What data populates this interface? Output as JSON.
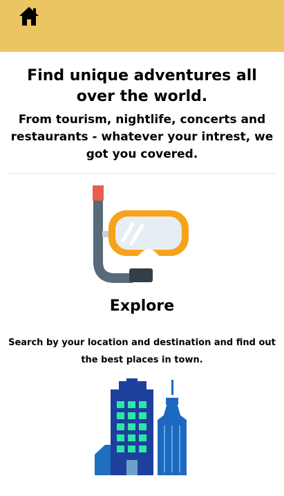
{
  "header": {
    "home_icon": "home-icon",
    "background_color": "#ecc563"
  },
  "hero": {
    "headline": "Find unique adventures all over the world.",
    "subheadline": "From tourism, nightlife, concerts and restaurants - whatever your intrest, we got you covered."
  },
  "features": [
    {
      "icon": "snorkel-mask-icon",
      "title": "Explore",
      "description": "Search by your location and destination and find out the best places in town."
    },
    {
      "icon": "city-buildings-icon",
      "title": "",
      "description": ""
    }
  ]
}
